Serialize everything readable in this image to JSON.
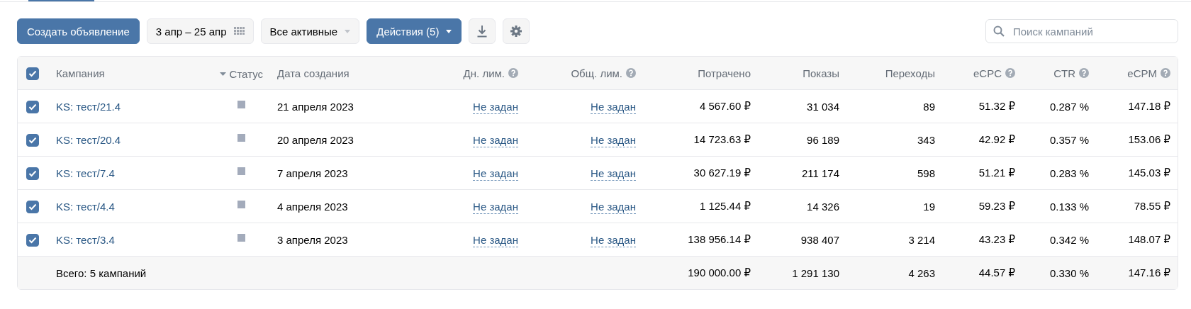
{
  "toolbar": {
    "create_button": "Создать объявление",
    "date_range": "3 апр – 25 апр",
    "filter": "Все активные",
    "actions_button": "Действия (5)",
    "search": {
      "placeholder": "Поиск кампаний"
    }
  },
  "table": {
    "select_all": {
      "checked": true
    },
    "columns": [
      {
        "label": "Кампания",
        "help": false,
        "sorted": false
      },
      {
        "label": "Статус",
        "help": false,
        "sorted": true
      },
      {
        "label": "Дата создания",
        "help": false,
        "sorted": false
      },
      {
        "label": "Дн. лим.",
        "help": true,
        "sorted": false
      },
      {
        "label": "Общ. лим.",
        "help": true,
        "sorted": false
      },
      {
        "label": "Потрачено",
        "help": false,
        "sorted": false
      },
      {
        "label": "Показы",
        "help": false,
        "sorted": false
      },
      {
        "label": "Переходы",
        "help": false,
        "sorted": false
      },
      {
        "label": "eCPC",
        "help": true,
        "sorted": false
      },
      {
        "label": "CTR",
        "help": true,
        "sorted": false
      },
      {
        "label": "eCPM",
        "help": true,
        "sorted": false
      }
    ],
    "rows": [
      {
        "checked": true,
        "name": "KS: тест/21.4",
        "color": "#a3abbb",
        "created": "21 апреля 2023",
        "daily_limit": "Не задан",
        "total_limit": "Не задан",
        "spent": "4 567.60 ₽",
        "impressions": "31 034",
        "clicks": "89",
        "ecpc": "51.32 ₽",
        "ctr": "0.287 %",
        "ecpm": "147.18 ₽"
      },
      {
        "checked": true,
        "name": "KS: тест/20.4",
        "color": "#a3abbb",
        "created": "20 апреля 2023",
        "daily_limit": "Не задан",
        "total_limit": "Не задан",
        "spent": "14 723.63 ₽",
        "impressions": "96 189",
        "clicks": "343",
        "ecpc": "42.92 ₽",
        "ctr": "0.357 %",
        "ecpm": "153.06 ₽"
      },
      {
        "checked": true,
        "name": "KS: тест/7.4",
        "color": "#a3abbb",
        "created": "7 апреля 2023",
        "daily_limit": "Не задан",
        "total_limit": "Не задан",
        "spent": "30 627.19 ₽",
        "impressions": "211 174",
        "clicks": "598",
        "ecpc": "51.21 ₽",
        "ctr": "0.283 %",
        "ecpm": "145.03 ₽"
      },
      {
        "checked": true,
        "name": "KS: тест/4.4",
        "color": "#a3abbb",
        "created": "4 апреля 2023",
        "daily_limit": "Не задан",
        "total_limit": "Не задан",
        "spent": "1 125.44 ₽",
        "impressions": "14 326",
        "clicks": "19",
        "ecpc": "59.23 ₽",
        "ctr": "0.133 %",
        "ecpm": "78.55 ₽"
      },
      {
        "checked": true,
        "name": "KS: тест/3.4",
        "color": "#a3abbb",
        "created": "3 апреля 2023",
        "daily_limit": "Не задан",
        "total_limit": "Не задан",
        "spent": "138 956.14 ₽",
        "impressions": "938 407",
        "clicks": "3 214",
        "ecpc": "43.23 ₽",
        "ctr": "0.342 %",
        "ecpm": "148.07 ₽"
      }
    ],
    "total": {
      "label": "Всего: 5 кампаний",
      "spent": "190 000.00 ₽",
      "impressions": "1 291 130",
      "clicks": "4 263",
      "ecpc": "44.57 ₽",
      "ctr": "0.330 %",
      "ecpm": "147.16 ₽"
    }
  }
}
